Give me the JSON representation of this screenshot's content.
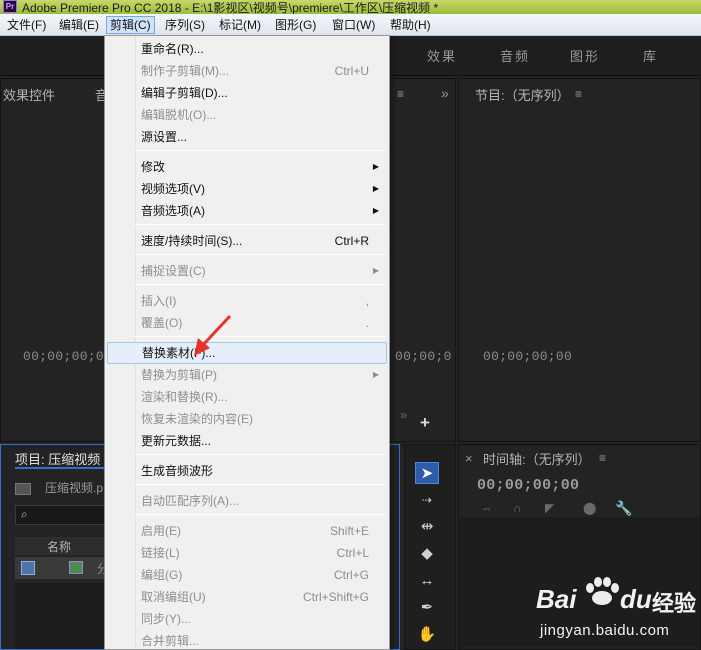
{
  "app": {
    "icon_text": "Pr",
    "title": "Adobe Premiere Pro CC 2018 - E:\\1影视区\\视频号\\premiere\\工作区\\压缩视频 *"
  },
  "menubar": {
    "items": [
      "文件(F)",
      "编辑(E)",
      "剪辑(C)",
      "序列(S)",
      "标记(M)",
      "图形(G)",
      "窗口(W)",
      "帮助(H)"
    ]
  },
  "workspaces": [
    "效果",
    "音频",
    "图形",
    "库"
  ],
  "source_panel": {
    "title": "效果控件",
    "title2": "音",
    "timecode": "00;00;00;00",
    "timecode2": "00;00;0"
  },
  "program_panel": {
    "title": "节目:（无序列）",
    "timecode": "00;00;00;00"
  },
  "project_panel": {
    "title": "项目: 压缩视频",
    "bin_name": "压缩视频.p",
    "col_name": "名称",
    "row_text": "分"
  },
  "timeline_panel": {
    "title": "时间轴:（无序列）",
    "timecode": "00;00;00;00"
  },
  "clip_menu": {
    "items": [
      {
        "label": "重命名(R)...",
        "shortcut": "",
        "submenu": false,
        "disabled": false
      },
      {
        "label": "制作子剪辑(M)...",
        "shortcut": "Ctrl+U",
        "submenu": false,
        "disabled": true
      },
      {
        "label": "编辑子剪辑(D)...",
        "shortcut": "",
        "submenu": false,
        "disabled": false
      },
      {
        "label": "编辑脱机(O)...",
        "shortcut": "",
        "submenu": false,
        "disabled": true
      },
      {
        "label": "源设置...",
        "shortcut": "",
        "submenu": false,
        "disabled": false
      },
      {
        "label": "修改",
        "shortcut": "",
        "submenu": true,
        "disabled": false
      },
      {
        "label": "视频选项(V)",
        "shortcut": "",
        "submenu": true,
        "disabled": false
      },
      {
        "label": "音频选项(A)",
        "shortcut": "",
        "submenu": true,
        "disabled": false
      },
      {
        "label": "速度/持续时间(S)...",
        "shortcut": "Ctrl+R",
        "submenu": false,
        "disabled": false
      },
      {
        "label": "捕捉设置(C)",
        "shortcut": "",
        "submenu": true,
        "disabled": true
      },
      {
        "label": "插入(I)",
        "shortcut": ",",
        "submenu": false,
        "disabled": true
      },
      {
        "label": "覆盖(O)",
        "shortcut": ".",
        "submenu": false,
        "disabled": true
      },
      {
        "label": "替换素材(F)...",
        "shortcut": "",
        "submenu": false,
        "disabled": false
      },
      {
        "label": "替换为剪辑(P)",
        "shortcut": "",
        "submenu": true,
        "disabled": true
      },
      {
        "label": "渲染和替换(R)...",
        "shortcut": "",
        "submenu": false,
        "disabled": true
      },
      {
        "label": "恢复未渲染的内容(E)",
        "shortcut": "",
        "submenu": false,
        "disabled": true
      },
      {
        "label": "更新元数据...",
        "shortcut": "",
        "submenu": false,
        "disabled": false
      },
      {
        "label": "生成音频波形",
        "shortcut": "",
        "submenu": false,
        "disabled": false
      },
      {
        "label": "自动匹配序列(A)...",
        "shortcut": "",
        "submenu": false,
        "disabled": true
      },
      {
        "label": "启用(E)",
        "shortcut": "Shift+E",
        "submenu": false,
        "disabled": true
      },
      {
        "label": "链接(L)",
        "shortcut": "Ctrl+L",
        "submenu": false,
        "disabled": true
      },
      {
        "label": "编组(G)",
        "shortcut": "Ctrl+G",
        "submenu": false,
        "disabled": true
      },
      {
        "label": "取消编组(U)",
        "shortcut": "Ctrl+Shift+G",
        "submenu": false,
        "disabled": true
      },
      {
        "label": "同步(Y)...",
        "shortcut": "",
        "submenu": false,
        "disabled": true
      },
      {
        "label": "合并剪辑...",
        "shortcut": "",
        "submenu": false,
        "disabled": true
      }
    ]
  },
  "watermark": {
    "brand": "Bai",
    "brand2": "du",
    "cn": "经验",
    "url": "jingyan.baidu.com"
  },
  "colors": {
    "accent_blue": "#2f6fd6",
    "arrow_red": "#e8332b"
  }
}
